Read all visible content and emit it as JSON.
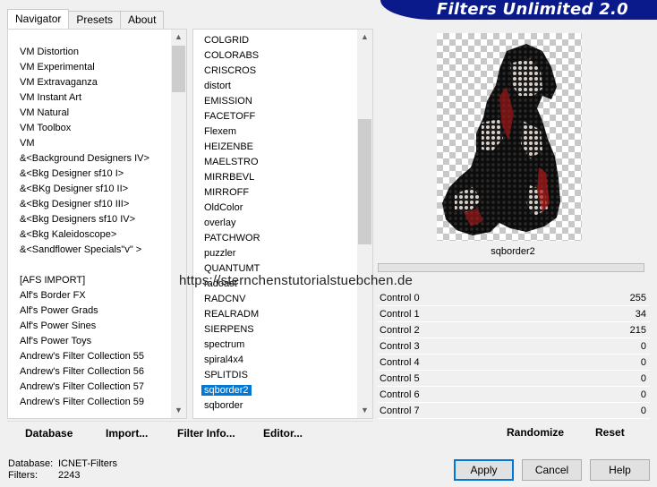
{
  "tabs": [
    {
      "label": "Navigator",
      "active": true
    },
    {
      "label": "Presets",
      "active": false
    },
    {
      "label": "About",
      "active": false
    }
  ],
  "title": "Filters Unlimited 2.0",
  "categories": {
    "items_top": [
      "VM Distortion",
      "VM Experimental",
      "VM Extravaganza",
      "VM Instant Art",
      "VM Natural",
      "VM Toolbox",
      "VM",
      "&<Background Designers IV>",
      "&<Bkg Designer sf10 I>",
      "&<BKg Designer sf10 II>",
      "&<Bkg Designer sf10 III>",
      "&<Bkg Designers sf10 IV>",
      "&<Bkg Kaleidoscope>",
      "&<Sandflower Specials\"v\" >"
    ],
    "items_bottom": [
      "[AFS IMPORT]",
      "Alf's Border FX",
      "Alf's Power Grads",
      "Alf's Power Sines",
      "Alf's Power Toys",
      "Andrew's Filter Collection 55",
      "Andrew's Filter Collection 56",
      "Andrew's Filter Collection 57",
      "Andrew's Filter Collection 59"
    ]
  },
  "filters": {
    "items": [
      "COLGRID",
      "COLORABS",
      "CRISCROS",
      "distort",
      "EMISSION",
      "FACETOFF",
      "Flexem",
      "HEIZENBE",
      "MAELSTRO",
      "MIRRBEVL",
      "MIRROFF",
      "OldColor",
      "overlay",
      "PATCHWOR",
      "puzzler",
      "QUANTUMT",
      "radoast",
      "RADCNV",
      "REALRADM",
      "SIERPENS",
      "spectrum",
      "spiral4x4",
      "SPLITDIS",
      "sqborder2",
      "sqborder"
    ],
    "selected": "sqborder2"
  },
  "preview": {
    "filter_name": "sqborder2",
    "controls": [
      {
        "label": "Control 0",
        "value": "255"
      },
      {
        "label": "Control 1",
        "value": "34"
      },
      {
        "label": "Control 2",
        "value": "215"
      },
      {
        "label": "Control 3",
        "value": "0"
      },
      {
        "label": "Control 4",
        "value": "0"
      },
      {
        "label": "Control 5",
        "value": "0"
      },
      {
        "label": "Control 6",
        "value": "0"
      },
      {
        "label": "Control 7",
        "value": "0"
      }
    ]
  },
  "bottom_buttons": {
    "database": "Database",
    "import": "Import...",
    "filter_info": "Filter Info...",
    "editor": "Editor...",
    "randomize": "Randomize",
    "reset": "Reset"
  },
  "status": {
    "database_label": "Database:",
    "database_value": "ICNET-Filters",
    "filters_label": "Filters:",
    "filters_value": "2243"
  },
  "dialog_buttons": {
    "apply": "Apply",
    "cancel": "Cancel",
    "help": "Help"
  },
  "watermark": "https://sternchenstutorialstuebchen.de",
  "colors": {
    "banner": "#0a1a8a",
    "selection": "#0078d7"
  }
}
